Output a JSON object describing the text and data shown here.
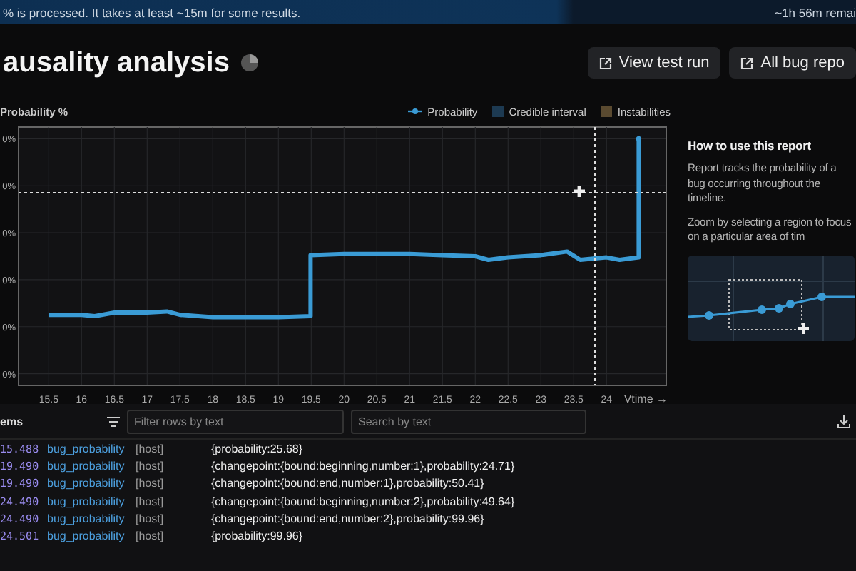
{
  "banner": {
    "message": "% is processed. It takes at least ~15m for some results.",
    "remaining": "~1h 56m remai"
  },
  "header": {
    "title": "ausality analysis",
    "buttons": [
      "View test run",
      "All bug repo"
    ]
  },
  "chart": {
    "legend": [
      {
        "label": "Probability",
        "kind": "line",
        "color": "#3a9bd5"
      },
      {
        "label": "Credible interval",
        "kind": "box",
        "color": "#1d3a52"
      },
      {
        "label": "Instabilities",
        "kind": "box",
        "color": "#5a4a30"
      }
    ],
    "ylabel": "Probability %",
    "xlabel": "Vtime →",
    "x_ticks": [
      "15.5",
      "16",
      "16.5",
      "17",
      "17.5",
      "18",
      "18.5",
      "19",
      "19.5",
      "20",
      "20.5",
      "21",
      "21.5",
      "22",
      "22.5",
      "23",
      "23.5",
      "24"
    ],
    "y_ticks": [
      "0%",
      "0%",
      "0%",
      "0%",
      "0%",
      "0%"
    ]
  },
  "help": {
    "title": "How to use this report",
    "paragraphs": [
      "Report tracks the probability of a bug occurring throughout the timeline.",
      "Zoom by selecting a region to focus on a particular area of tim"
    ]
  },
  "table": {
    "label": "ems",
    "filter_placeholder": "Filter rows by text",
    "search_placeholder": "Search by text",
    "rows": [
      {
        "time": "15.488",
        "name": "bug_probability",
        "tag": "[host]",
        "data": "{probability:25.68}"
      },
      {
        "time": "19.490",
        "name": "bug_probability",
        "tag": "[host]",
        "data": "{changepoint:{bound:beginning,number:1},probability:24.71}"
      },
      {
        "time": "19.490",
        "name": "bug_probability",
        "tag": "[host]",
        "data": "{changepoint:{bound:end,number:1},probability:50.41}"
      },
      {
        "time": "24.490",
        "name": "bug_probability",
        "tag": "[host]",
        "data": "{changepoint:{bound:beginning,number:2},probability:49.64}"
      },
      {
        "time": "24.490",
        "name": "bug_probability",
        "tag": "[host]",
        "data": "{changepoint:{bound:end,number:2},probability:99.96}"
      },
      {
        "time": "24.501",
        "name": "bug_probability",
        "tag": "[host]",
        "data": "{probability:99.96}"
      }
    ]
  }
}
